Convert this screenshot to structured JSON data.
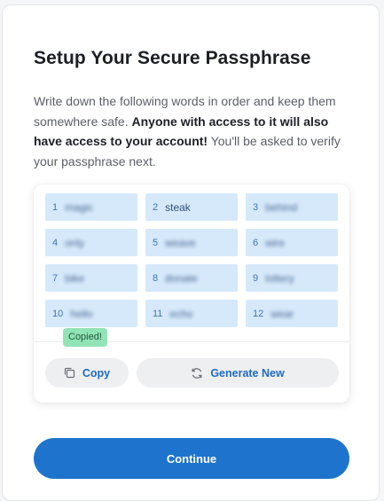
{
  "header": {
    "title": "Setup Your Secure Passphrase"
  },
  "description": {
    "part1": "Write down the following words in order and keep them somewhere safe. ",
    "bold": "Anyone with access to it will also have access to your account!",
    "part2": " You'll be asked to verify your passphrase next."
  },
  "passphrase": {
    "words": [
      {
        "num": "1",
        "text": "magic",
        "blurred": true
      },
      {
        "num": "2",
        "text": "steak",
        "blurred": false
      },
      {
        "num": "3",
        "text": "behind",
        "blurred": true
      },
      {
        "num": "4",
        "text": "only",
        "blurred": true
      },
      {
        "num": "5",
        "text": "weave",
        "blurred": true
      },
      {
        "num": "6",
        "text": "wire",
        "blurred": true
      },
      {
        "num": "7",
        "text": "bike",
        "blurred": true
      },
      {
        "num": "8",
        "text": "donate",
        "blurred": true
      },
      {
        "num": "9",
        "text": "lottery",
        "blurred": true
      },
      {
        "num": "10",
        "text": "hello",
        "blurred": true
      },
      {
        "num": "11",
        "text": "echo",
        "blurred": true
      },
      {
        "num": "12",
        "text": "wear",
        "blurred": true
      }
    ],
    "copied_badge": "Copied!",
    "copy_label": "Copy",
    "generate_label": "Generate New"
  },
  "footer": {
    "continue_label": "Continue"
  },
  "colors": {
    "accent": "#1e74cc",
    "word_bg": "#d6e9fb",
    "badge_bg": "#92e3b6"
  },
  "icons": {
    "copy": "copy-icon",
    "generate": "refresh-icon"
  }
}
